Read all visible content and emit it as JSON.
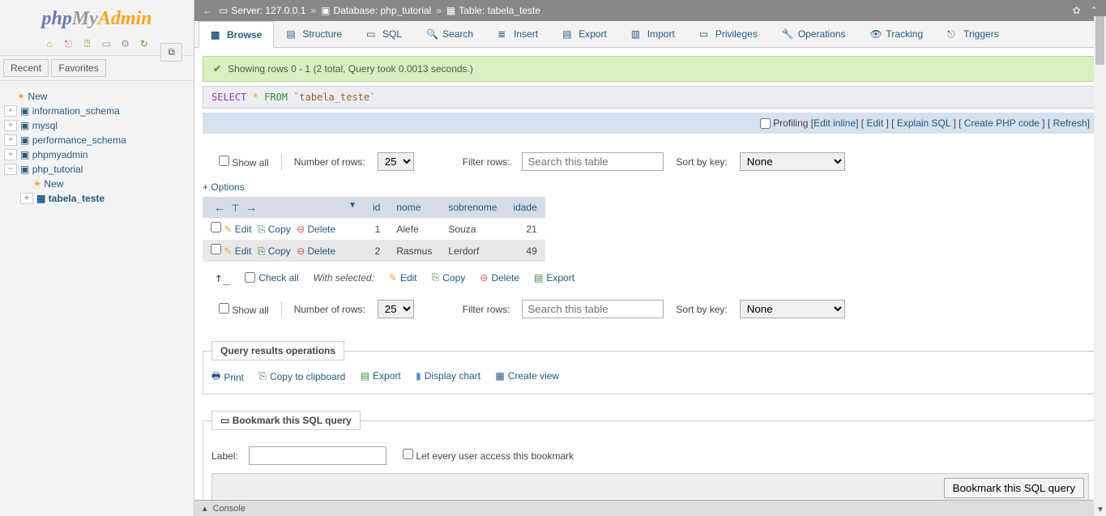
{
  "logo": {
    "php": "php",
    "my": "My",
    "admin": "Admin"
  },
  "sidebar": {
    "recent": "Recent",
    "favorites": "Favorites",
    "items": [
      {
        "label": "New"
      },
      {
        "label": "information_schema"
      },
      {
        "label": "mysql"
      },
      {
        "label": "performance_schema"
      },
      {
        "label": "phpmyadmin"
      },
      {
        "label": "php_tutorial"
      },
      {
        "label": "New"
      },
      {
        "label": "tabela_teste"
      }
    ]
  },
  "breadcrumb": {
    "server_label": "Server:",
    "server_value": "127.0.0.1",
    "database_label": "Database:",
    "database_value": "php_tutorial",
    "table_label": "Table:",
    "table_value": "tabela_teste"
  },
  "tabs": [
    "Browse",
    "Structure",
    "SQL",
    "Search",
    "Insert",
    "Export",
    "Import",
    "Privileges",
    "Operations",
    "Tracking",
    "Triggers"
  ],
  "success": "Showing rows 0 - 1 (2 total, Query took 0.0013 seconds.)",
  "sql": {
    "select": "SELECT",
    "star": "*",
    "from": "FROM",
    "table": "`tabela_teste`"
  },
  "actions": {
    "profiling": "Profiling",
    "edit_inline": "Edit inline",
    "edit": "Edit",
    "explain": "Explain SQL",
    "create_php": "Create PHP code",
    "refresh": "Refresh"
  },
  "filter": {
    "show_all": "Show all",
    "num_rows": "Number of rows:",
    "num_value": "25",
    "filter_rows": "Filter rows:",
    "placeholder": "Search this table",
    "sort_by": "Sort by key:",
    "sort_value": "None"
  },
  "options": "+ Options",
  "columns": [
    "id",
    "nome",
    "sobrenome",
    "idade"
  ],
  "rows": [
    {
      "id": "1",
      "nome": "Alefe",
      "sobrenome": "Souza",
      "idade": "21"
    },
    {
      "id": "2",
      "nome": "Rasmus",
      "sobrenome": "Lerdorf",
      "idade": "49"
    }
  ],
  "row_actions": {
    "edit": "Edit",
    "copy": "Copy",
    "delete": "Delete"
  },
  "bulk": {
    "check_all": "Check all",
    "with_selected": "With selected:",
    "edit": "Edit",
    "copy": "Copy",
    "delete": "Delete",
    "export": "Export"
  },
  "ops": {
    "title": "Query results operations",
    "print": "Print",
    "copy_clip": "Copy to clipboard",
    "export": "Export",
    "chart": "Display chart",
    "create_view": "Create view"
  },
  "bookmark": {
    "title": "Bookmark this SQL query",
    "label": "Label:",
    "public": "Let every user access this bookmark",
    "button": "Bookmark this SQL query"
  },
  "console": "Console"
}
